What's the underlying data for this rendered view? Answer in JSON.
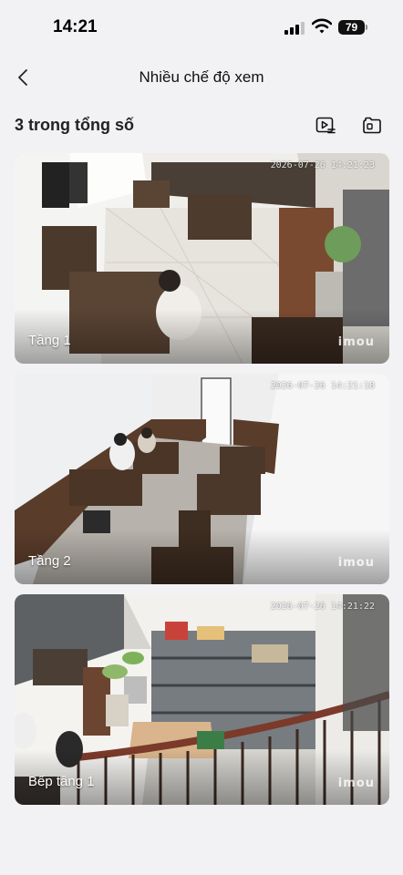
{
  "status_bar": {
    "time": "14:21",
    "battery": "79",
    "signal_bars_active": 3,
    "signal_bars_total": 4
  },
  "nav": {
    "title": "Nhiều chế độ xem",
    "back_icon": "chevron-left-icon"
  },
  "subheader": {
    "count_label": "3 trong tổng số",
    "playback_icon": "video-playback-icon",
    "split_view_icon": "split-view-icon"
  },
  "cameras": [
    {
      "name": "Tầng 1",
      "timestamp": "2026-07-26 14:21:23",
      "logo": "imou"
    },
    {
      "name": "Tầng 2",
      "timestamp": "2026-07-26 14:21:18",
      "logo": "imou"
    },
    {
      "name": "Bếp tầng 1",
      "timestamp": "2026-07-26 14:21:22",
      "logo": "imou"
    }
  ],
  "colors": {
    "background": "#f2f2f4",
    "text": "#111111",
    "tile_overlay_text": "#ffffff"
  }
}
